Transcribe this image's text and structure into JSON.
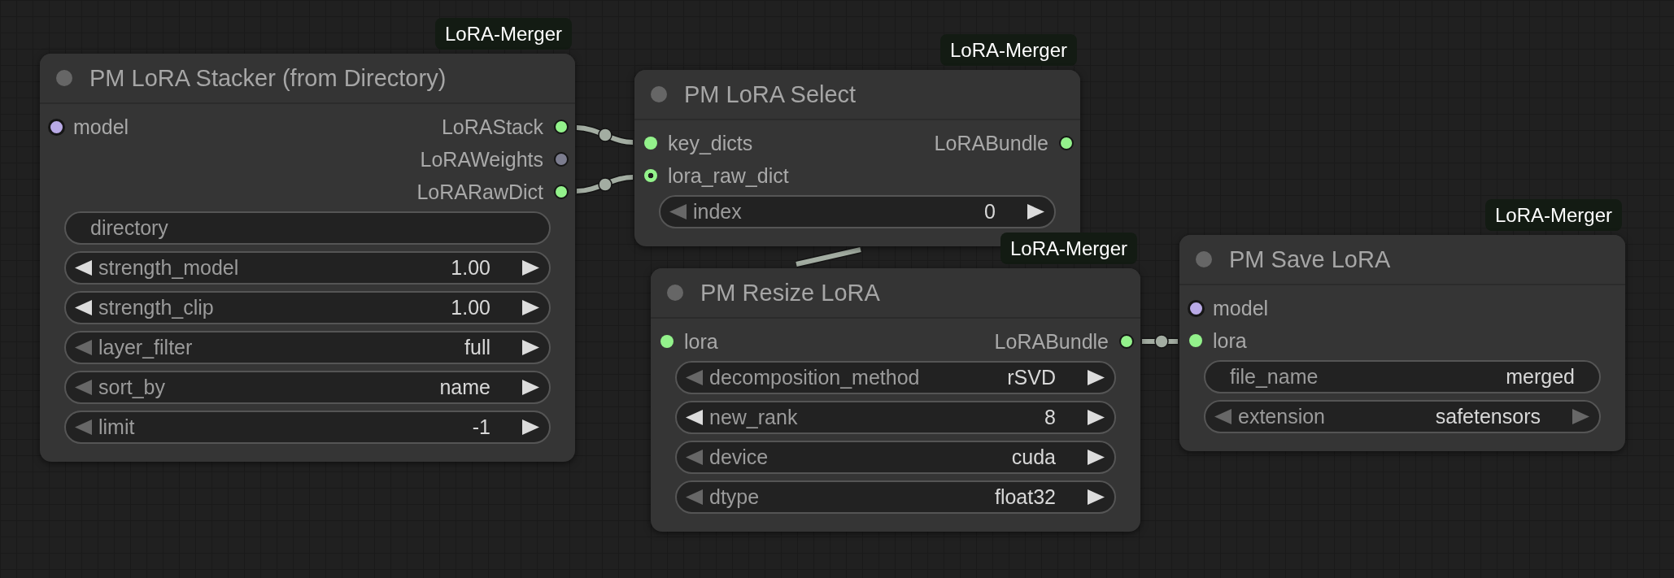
{
  "nodes": [
    {
      "title": "PM LoRA Stacker (from Directory)",
      "badge": "LoRA-Merger",
      "inputs": [
        {
          "label": "model",
          "color": "#b9aae6",
          "kind": "ringed"
        }
      ],
      "outputs": [
        {
          "label": "LoRAStack",
          "color": "#93f28b",
          "kind": "outlined"
        },
        {
          "label": "LoRAWeights",
          "color": "#7c7d8f",
          "kind": "outlined"
        },
        {
          "label": "LoRARawDict",
          "color": "#93f28b",
          "kind": "outlined"
        }
      ],
      "widgets": [
        {
          "kind": "text",
          "label": "directory"
        },
        {
          "kind": "stepper",
          "label": "strength_model",
          "value": "1.00",
          "decrement_enabled": true,
          "increment_enabled": true
        },
        {
          "kind": "stepper",
          "label": "strength_clip",
          "value": "1.00",
          "decrement_enabled": true,
          "increment_enabled": true
        },
        {
          "kind": "stepper",
          "label": "layer_filter",
          "value": "full",
          "decrement_enabled": false,
          "increment_enabled": true
        },
        {
          "kind": "stepper",
          "label": "sort_by",
          "value": "name",
          "decrement_enabled": false,
          "increment_enabled": true
        },
        {
          "kind": "stepper",
          "label": "limit",
          "value": "-1",
          "decrement_enabled": false,
          "increment_enabled": true
        }
      ]
    },
    {
      "title": "PM LoRA Select",
      "badge": "LoRA-Merger",
      "inputs": [
        {
          "label": "key_dicts",
          "color": "#93f28b",
          "kind": "plain"
        },
        {
          "label": "lora_raw_dict",
          "color": "#93f28b",
          "kind": "dotted"
        }
      ],
      "outputs": [
        {
          "label": "LoRABundle",
          "color": "#93f28b",
          "kind": "outlined"
        }
      ],
      "widgets": [
        {
          "kind": "stepper",
          "label": "index",
          "value": "0",
          "decrement_enabled": false,
          "increment_enabled": true
        }
      ]
    },
    {
      "title": "PM Resize LoRA",
      "badge": "LoRA-Merger",
      "inputs": [
        {
          "label": "lora",
          "color": "#93f28b",
          "kind": "plain"
        }
      ],
      "outputs": [
        {
          "label": "LoRABundle",
          "color": "#93f28b",
          "kind": "outlined"
        }
      ],
      "widgets": [
        {
          "kind": "stepper",
          "label": "decomposition_method",
          "value": "rSVD",
          "decrement_enabled": false,
          "increment_enabled": true
        },
        {
          "kind": "stepper",
          "label": "new_rank",
          "value": "8",
          "decrement_enabled": true,
          "increment_enabled": true
        },
        {
          "kind": "stepper",
          "label": "device",
          "value": "cuda",
          "decrement_enabled": false,
          "increment_enabled": true
        },
        {
          "kind": "stepper",
          "label": "dtype",
          "value": "float32",
          "decrement_enabled": false,
          "increment_enabled": true
        }
      ]
    },
    {
      "title": "PM Save LoRA",
      "badge": "LoRA-Merger",
      "inputs": [
        {
          "label": "model",
          "color": "#b9aae6",
          "kind": "ringed"
        },
        {
          "label": "lora",
          "color": "#93f28b",
          "kind": "plain"
        }
      ],
      "widgets": [
        {
          "kind": "text",
          "label": "file_name",
          "value": "merged"
        },
        {
          "kind": "stepper",
          "label": "extension",
          "value": "safetensors",
          "decrement_enabled": false,
          "increment_enabled": false
        }
      ]
    }
  ]
}
